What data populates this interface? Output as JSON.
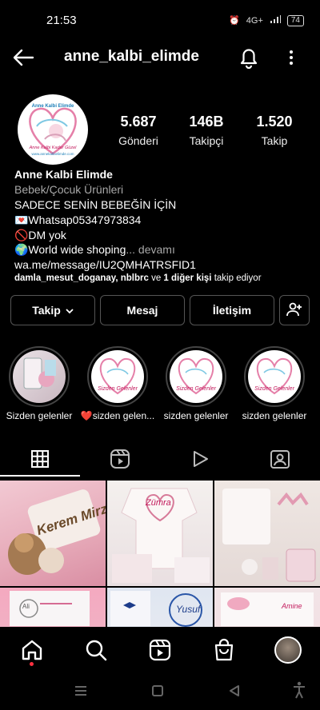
{
  "status": {
    "time": "21:53",
    "network": "4G+",
    "battery": "74"
  },
  "header": {
    "username": "anne_kalbi_elimde"
  },
  "profile": {
    "avatar_text": {
      "brand": "Anne Kalbi Elimde",
      "tag": "Anne Kalbi Kadar Güzel",
      "site": "www.annekalbielimde.com"
    },
    "stats": [
      {
        "value": "5.687",
        "label": "Gönderi"
      },
      {
        "value": "146B",
        "label": "Takipçi"
      },
      {
        "value": "1.520",
        "label": "Takip"
      }
    ],
    "name": "Anne Kalbi Elimde",
    "category": "Bebek/Çocuk Ürünleri",
    "bio_lines": [
      "SADECE SENİN BEBEĞİN  İÇİN",
      "💌Whatsap05347973834",
      "🚫DM yok",
      "🌍World wide shoping"
    ],
    "more": "... devamı",
    "link": "wa.me/message/IU2QMHATRSFID1",
    "followed_names": "damla_mesut_doganay, nblbrc",
    "followed_ve": " ve ",
    "followed_other": "1 diğer kişi",
    "followed_suffix": " takip ediyor"
  },
  "buttons": {
    "follow": "Takip",
    "message": "Mesaj",
    "contact": "İletişim"
  },
  "highlights": [
    {
      "label": "Sizden gelenler",
      "inner": ""
    },
    {
      "label": "❤️sizden gelen...",
      "inner": "Sizden Gelenler"
    },
    {
      "label": "sizden gelenler",
      "inner": "Sizden Gelenler"
    },
    {
      "label": "sizden gelenler",
      "inner": "Sizden Gelenler"
    }
  ],
  "grid": [
    {
      "caption": "Kerem Mirza"
    },
    {
      "caption": "Zümra"
    },
    {
      "caption": ""
    },
    {
      "caption": "Ali"
    },
    {
      "caption": "Yusuf"
    },
    {
      "caption": "Amine"
    }
  ],
  "colors": {
    "accent": "#ffffff",
    "muted": "#a8a8a8",
    "notif_dot": "#ff3040",
    "border": "#555555"
  }
}
